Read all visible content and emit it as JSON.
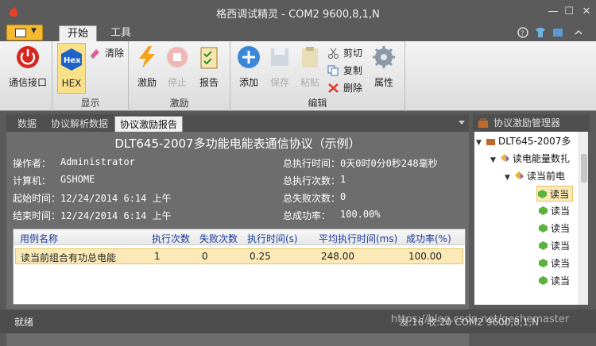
{
  "window": {
    "title": "格西调试精灵 - COM2  9600,8,1,N"
  },
  "ribbon_tabs": {
    "start": "开始",
    "tools": "工具"
  },
  "ribbon": {
    "comm_interface": "通信接口",
    "hex": "HEX",
    "hex_icon_text": "Hex",
    "clear": "清除",
    "group_display": "显示",
    "stimulate": "激励",
    "stop": "停止",
    "report": "报告",
    "group_stimulate": "激励",
    "add": "添加",
    "save": "保存",
    "paste": "粘贴",
    "cut": "剪切",
    "copy": "复制",
    "delete": "删除",
    "properties": "属性",
    "group_edit": "编辑"
  },
  "doc_tabs": [
    "数据",
    "协议解析数据",
    "协议激励报告"
  ],
  "report": {
    "title": "DLT645-2007多功能电能表通信协议（示例）",
    "operator_label": "操作者：",
    "operator": "Administrator",
    "computer_label": "计算机：",
    "computer": "GSHOME",
    "start_label": "起始时间：",
    "start": "12/24/2014 6:14 上午",
    "end_label": "结束时间：",
    "end": "12/24/2014 6:14 上午",
    "total_time_label": "总执行时间：",
    "total_time": "0天0时0分0秒248毫秒",
    "total_count_label": "总执行次数：",
    "total_count": "1",
    "total_fail_label": "总失败次数：",
    "total_fail": "0",
    "success_rate_label": "总成功率：",
    "success_rate": "100.00%"
  },
  "grid": {
    "headers": [
      "用例名称",
      "执行次数",
      "失败次数",
      "执行时间(s)",
      "平均执行时间(ms)",
      "成功率(%)"
    ],
    "rows": [
      [
        "读当前组合有功总电能",
        "1",
        "0",
        "0.25",
        "248.00",
        "100.00"
      ]
    ]
  },
  "right_panel": {
    "title": "协议激励管理器",
    "tree": [
      {
        "label": "DLT645-2007多"
      },
      {
        "label": "读电能量数扎"
      },
      {
        "label": "读当前电"
      },
      {
        "label": "读当"
      },
      {
        "label": "读当"
      },
      {
        "label": "读当"
      },
      {
        "label": "读当"
      },
      {
        "label": "读当"
      },
      {
        "label": "读当"
      }
    ]
  },
  "status": {
    "left": "就绪",
    "right": "发:16  收:20     COM2  9600,8,1,N"
  },
  "watermark": "https://blog.csdn.net/geshemaster",
  "colors": {
    "accent": "#f5b932",
    "selected_row": "#fbeab8",
    "chrome": "#5b5b5b"
  }
}
